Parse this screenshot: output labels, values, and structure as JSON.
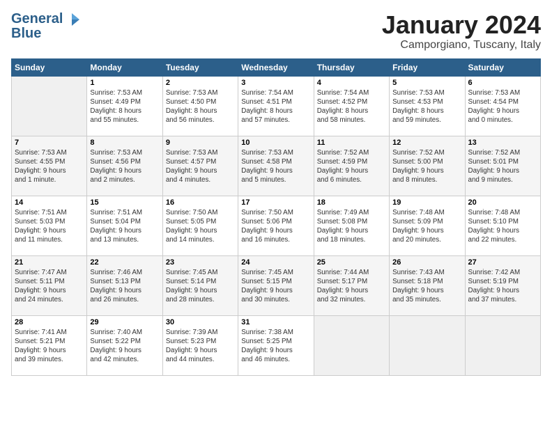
{
  "logo": {
    "line1": "General",
    "line2": "Blue"
  },
  "header": {
    "month": "January 2024",
    "location": "Camporgiano, Tuscany, Italy"
  },
  "days_of_week": [
    "Sunday",
    "Monday",
    "Tuesday",
    "Wednesday",
    "Thursday",
    "Friday",
    "Saturday"
  ],
  "weeks": [
    [
      {
        "day": "",
        "info": ""
      },
      {
        "day": "1",
        "info": "Sunrise: 7:53 AM\nSunset: 4:49 PM\nDaylight: 8 hours\nand 55 minutes."
      },
      {
        "day": "2",
        "info": "Sunrise: 7:53 AM\nSunset: 4:50 PM\nDaylight: 8 hours\nand 56 minutes."
      },
      {
        "day": "3",
        "info": "Sunrise: 7:54 AM\nSunset: 4:51 PM\nDaylight: 8 hours\nand 57 minutes."
      },
      {
        "day": "4",
        "info": "Sunrise: 7:54 AM\nSunset: 4:52 PM\nDaylight: 8 hours\nand 58 minutes."
      },
      {
        "day": "5",
        "info": "Sunrise: 7:53 AM\nSunset: 4:53 PM\nDaylight: 8 hours\nand 59 minutes."
      },
      {
        "day": "6",
        "info": "Sunrise: 7:53 AM\nSunset: 4:54 PM\nDaylight: 9 hours\nand 0 minutes."
      }
    ],
    [
      {
        "day": "7",
        "info": "Sunrise: 7:53 AM\nSunset: 4:55 PM\nDaylight: 9 hours\nand 1 minute."
      },
      {
        "day": "8",
        "info": "Sunrise: 7:53 AM\nSunset: 4:56 PM\nDaylight: 9 hours\nand 2 minutes."
      },
      {
        "day": "9",
        "info": "Sunrise: 7:53 AM\nSunset: 4:57 PM\nDaylight: 9 hours\nand 4 minutes."
      },
      {
        "day": "10",
        "info": "Sunrise: 7:53 AM\nSunset: 4:58 PM\nDaylight: 9 hours\nand 5 minutes."
      },
      {
        "day": "11",
        "info": "Sunrise: 7:52 AM\nSunset: 4:59 PM\nDaylight: 9 hours\nand 6 minutes."
      },
      {
        "day": "12",
        "info": "Sunrise: 7:52 AM\nSunset: 5:00 PM\nDaylight: 9 hours\nand 8 minutes."
      },
      {
        "day": "13",
        "info": "Sunrise: 7:52 AM\nSunset: 5:01 PM\nDaylight: 9 hours\nand 9 minutes."
      }
    ],
    [
      {
        "day": "14",
        "info": "Sunrise: 7:51 AM\nSunset: 5:03 PM\nDaylight: 9 hours\nand 11 minutes."
      },
      {
        "day": "15",
        "info": "Sunrise: 7:51 AM\nSunset: 5:04 PM\nDaylight: 9 hours\nand 13 minutes."
      },
      {
        "day": "16",
        "info": "Sunrise: 7:50 AM\nSunset: 5:05 PM\nDaylight: 9 hours\nand 14 minutes."
      },
      {
        "day": "17",
        "info": "Sunrise: 7:50 AM\nSunset: 5:06 PM\nDaylight: 9 hours\nand 16 minutes."
      },
      {
        "day": "18",
        "info": "Sunrise: 7:49 AM\nSunset: 5:08 PM\nDaylight: 9 hours\nand 18 minutes."
      },
      {
        "day": "19",
        "info": "Sunrise: 7:48 AM\nSunset: 5:09 PM\nDaylight: 9 hours\nand 20 minutes."
      },
      {
        "day": "20",
        "info": "Sunrise: 7:48 AM\nSunset: 5:10 PM\nDaylight: 9 hours\nand 22 minutes."
      }
    ],
    [
      {
        "day": "21",
        "info": "Sunrise: 7:47 AM\nSunset: 5:11 PM\nDaylight: 9 hours\nand 24 minutes."
      },
      {
        "day": "22",
        "info": "Sunrise: 7:46 AM\nSunset: 5:13 PM\nDaylight: 9 hours\nand 26 minutes."
      },
      {
        "day": "23",
        "info": "Sunrise: 7:45 AM\nSunset: 5:14 PM\nDaylight: 9 hours\nand 28 minutes."
      },
      {
        "day": "24",
        "info": "Sunrise: 7:45 AM\nSunset: 5:15 PM\nDaylight: 9 hours\nand 30 minutes."
      },
      {
        "day": "25",
        "info": "Sunrise: 7:44 AM\nSunset: 5:17 PM\nDaylight: 9 hours\nand 32 minutes."
      },
      {
        "day": "26",
        "info": "Sunrise: 7:43 AM\nSunset: 5:18 PM\nDaylight: 9 hours\nand 35 minutes."
      },
      {
        "day": "27",
        "info": "Sunrise: 7:42 AM\nSunset: 5:19 PM\nDaylight: 9 hours\nand 37 minutes."
      }
    ],
    [
      {
        "day": "28",
        "info": "Sunrise: 7:41 AM\nSunset: 5:21 PM\nDaylight: 9 hours\nand 39 minutes."
      },
      {
        "day": "29",
        "info": "Sunrise: 7:40 AM\nSunset: 5:22 PM\nDaylight: 9 hours\nand 42 minutes."
      },
      {
        "day": "30",
        "info": "Sunrise: 7:39 AM\nSunset: 5:23 PM\nDaylight: 9 hours\nand 44 minutes."
      },
      {
        "day": "31",
        "info": "Sunrise: 7:38 AM\nSunset: 5:25 PM\nDaylight: 9 hours\nand 46 minutes."
      },
      {
        "day": "",
        "info": ""
      },
      {
        "day": "",
        "info": ""
      },
      {
        "day": "",
        "info": ""
      }
    ]
  ]
}
